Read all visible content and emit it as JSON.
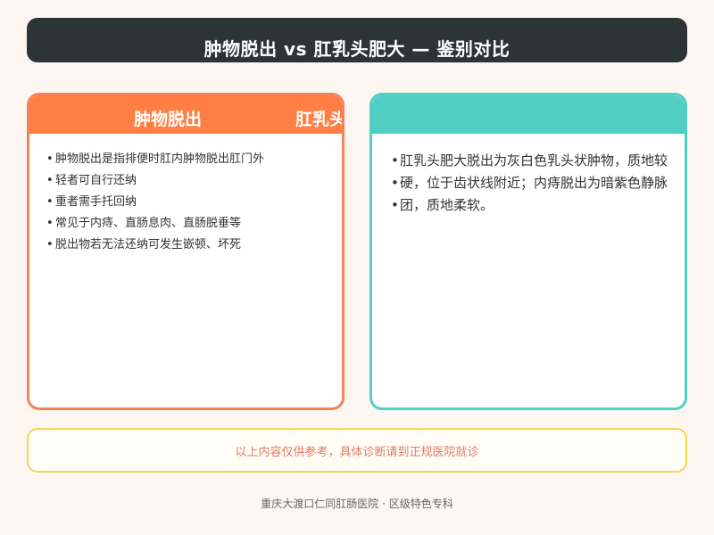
{
  "title": "肿物脱出 vs 肛乳头肥大 — 鉴别对比",
  "left_card": {
    "heading": "肿物脱出",
    "overflow_heading": "肛乳头肥大",
    "items": [
      "肿物脱出是指排便时肛内肿物脱出肛门外",
      "轻者可自行还纳",
      "重者需手托回纳",
      "常见于内痔、直肠息肉、直肠脱垂等",
      "脱出物若无法还纳可发生嵌顿、坏死"
    ]
  },
  "right_card": {
    "items": [
      "肛乳头肥大脱出为灰白色乳头状肿物，质地较",
      "硬，位于齿状线附近；内痔脱出为暗紫色静脉",
      "团，质地柔软。"
    ]
  },
  "disclaimer": "以上内容仅供参考，具体诊断请到正规医院就诊",
  "footer": "重庆大渡口仁同肛肠医院 · 区级特色专科",
  "colors": {
    "title_bg": "#2d3436",
    "left_accent": "#ff7e43",
    "right_accent": "#52cfc4",
    "disclaimer_border": "#f4d655",
    "disclaimer_text": "#e07a66"
  }
}
